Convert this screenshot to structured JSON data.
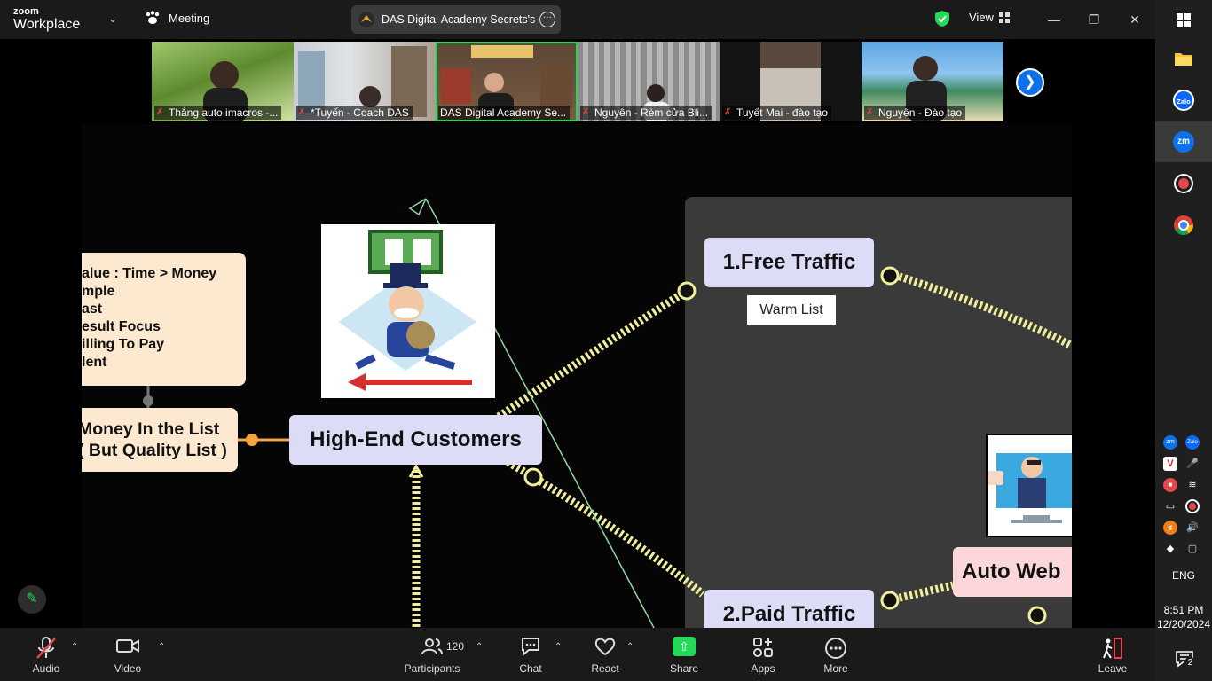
{
  "app": {
    "brand_line1": "zoom",
    "brand_line2": "Workplace"
  },
  "header": {
    "meeting_label": "Meeting",
    "share_title": "DAS Digital Academy Secrets's sc",
    "view_label": "View"
  },
  "participants_strip": [
    {
      "name": "Thắng auto imacros -..."
    },
    {
      "name": "*Tuyến - Coach DAS"
    },
    {
      "name": "DAS Digital Academy Se..."
    },
    {
      "name": "Nguyên - Rèm cửa Bli..."
    },
    {
      "name": "Tuyết Mai - đào tạo"
    },
    {
      "name": "Nguyên - Đào tạo"
    }
  ],
  "shared_screen": {
    "value_box": [
      "alue : Time > Money",
      "mple",
      "ast",
      "esult Focus",
      "illing To Pay",
      "lent"
    ],
    "money_box": [
      "Money In the List",
      "( But Quality List )"
    ],
    "high_end": "High-End Customers",
    "free_traffic": "1.Free Traffic",
    "warm_list": "Warm List",
    "paid_traffic": "2.Paid Traffic",
    "auto_web": "Auto Web"
  },
  "toolbar": {
    "audio": "Audio",
    "video": "Video",
    "participants": "Participants",
    "participants_count": "120",
    "chat": "Chat",
    "react": "React",
    "share": "Share",
    "apps": "Apps",
    "more": "More",
    "leave": "Leave"
  },
  "taskbar": {
    "language": "ENG",
    "time": "8:51 PM",
    "date": "12/20/2024",
    "notification_count": "2"
  },
  "colors": {
    "accent_green": "#23d959",
    "zoom_blue": "#0e71eb",
    "leave_red": "#e5474b"
  }
}
